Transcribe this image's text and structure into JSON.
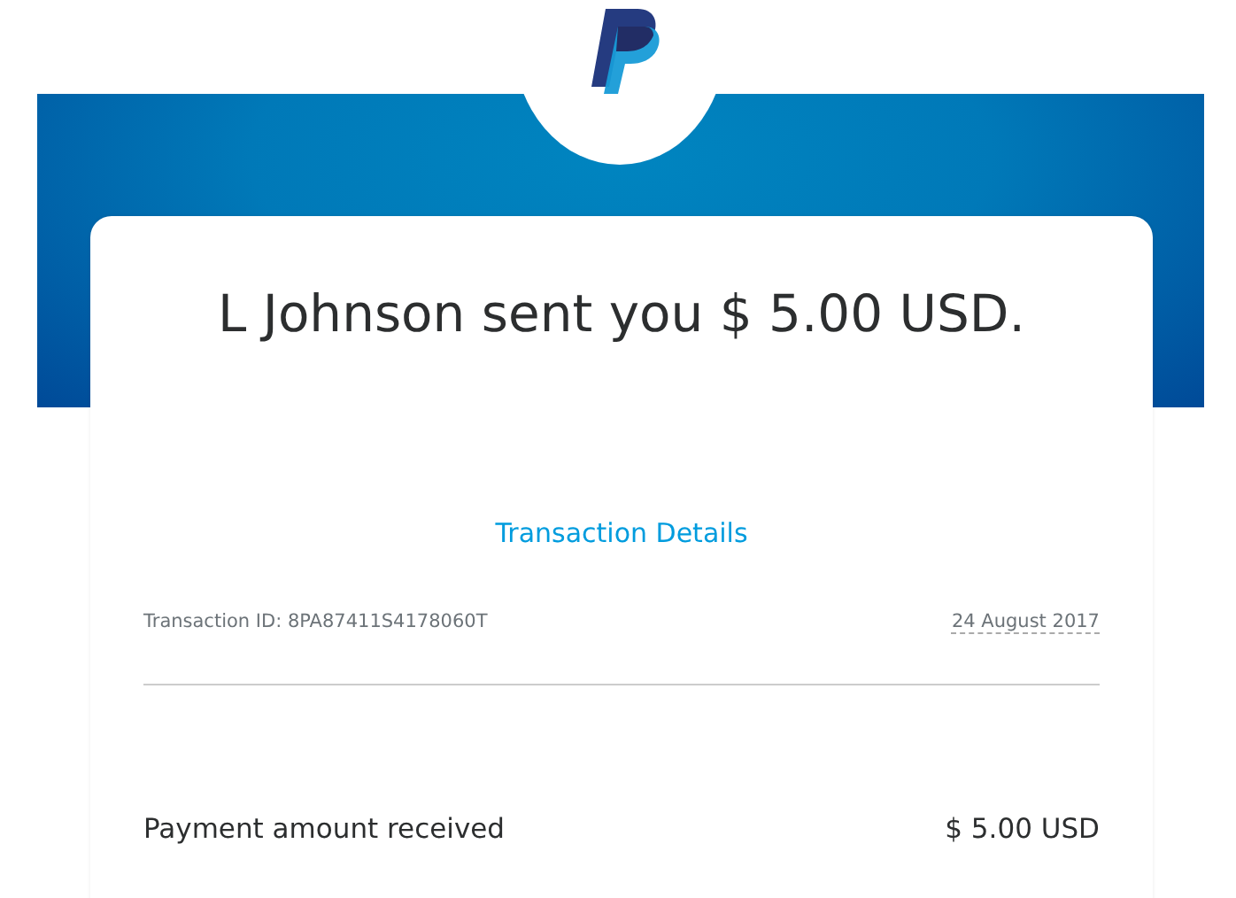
{
  "headline": "L Johnson sent you $ 5.00 USD.",
  "details_link": "Transaction Details",
  "transaction_id": "Transaction ID: 8PA87411S4178060T",
  "date": "24 August 2017",
  "rows": [
    {
      "label": "Payment amount received",
      "value": "$ 5.00 USD"
    }
  ]
}
